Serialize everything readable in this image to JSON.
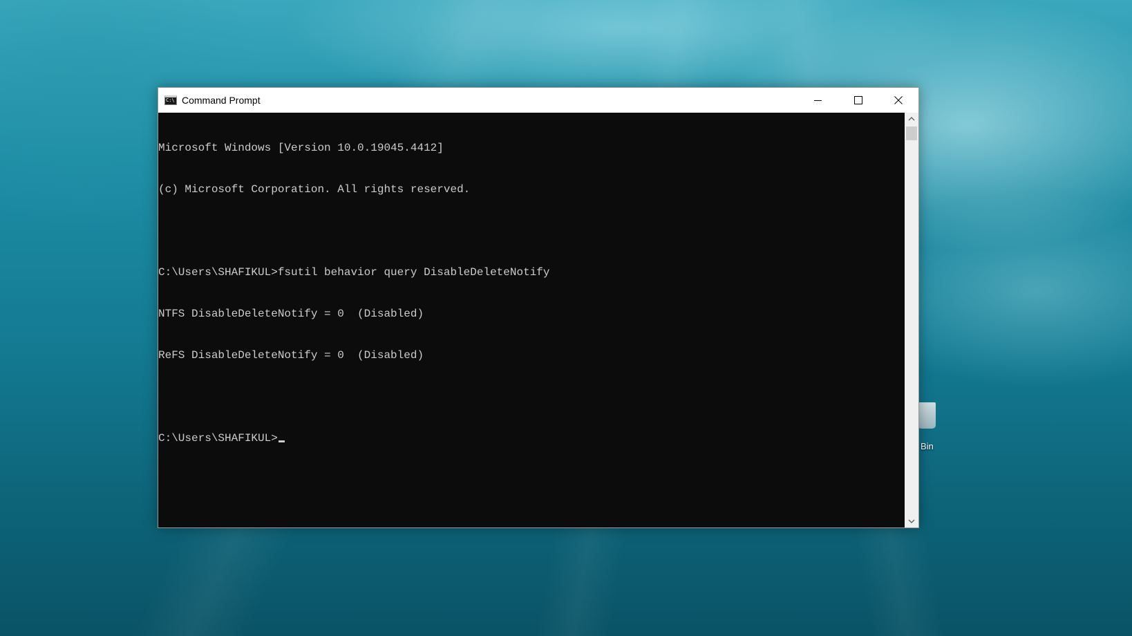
{
  "desktop": {
    "recycle_bin_label": "Bin"
  },
  "window": {
    "title": "Command Prompt",
    "icon": "cmd-icon",
    "controls": {
      "minimize_icon": "minimize-icon",
      "maximize_icon": "maximize-icon",
      "close_icon": "close-icon"
    }
  },
  "console": {
    "lines": [
      "Microsoft Windows [Version 10.0.19045.4412]",
      "(c) Microsoft Corporation. All rights reserved.",
      "",
      "C:\\Users\\SHAFIKUL>fsutil behavior query DisableDeleteNotify",
      "NTFS DisableDeleteNotify = 0  (Disabled)",
      "ReFS DisableDeleteNotify = 0  (Disabled)",
      "",
      "C:\\Users\\SHAFIKUL>"
    ]
  },
  "colors": {
    "console_background": "#0c0c0c",
    "console_text": "#cccccc",
    "titlebar_background": "#ffffff"
  }
}
